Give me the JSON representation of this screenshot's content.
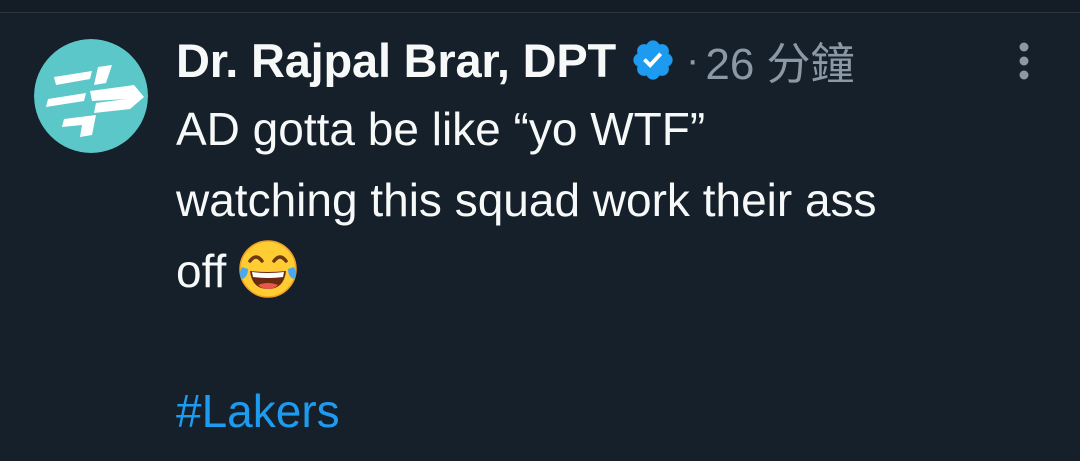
{
  "tweet": {
    "author": {
      "display_name": "Dr. Rajpal Brar, DPT",
      "avatar_icon": "logo-avatar-icon",
      "avatar_color": "#5cc7c8",
      "verified_icon": "verified-badge-icon",
      "verified_color": "#1d9bf0"
    },
    "separator": "·",
    "timestamp": "26 分鐘",
    "more_icon": "more-options-icon",
    "text_lines": [
      "AD gotta be like “yo WTF”",
      "watching this squad work their ass",
      "off"
    ],
    "emoji": "face-with-tears-of-joy",
    "hashtag": "#Lakers",
    "colors": {
      "background": "#15202b",
      "text": "#f7f9f9",
      "secondary": "#8b98a5",
      "link": "#1d9bf0"
    }
  }
}
